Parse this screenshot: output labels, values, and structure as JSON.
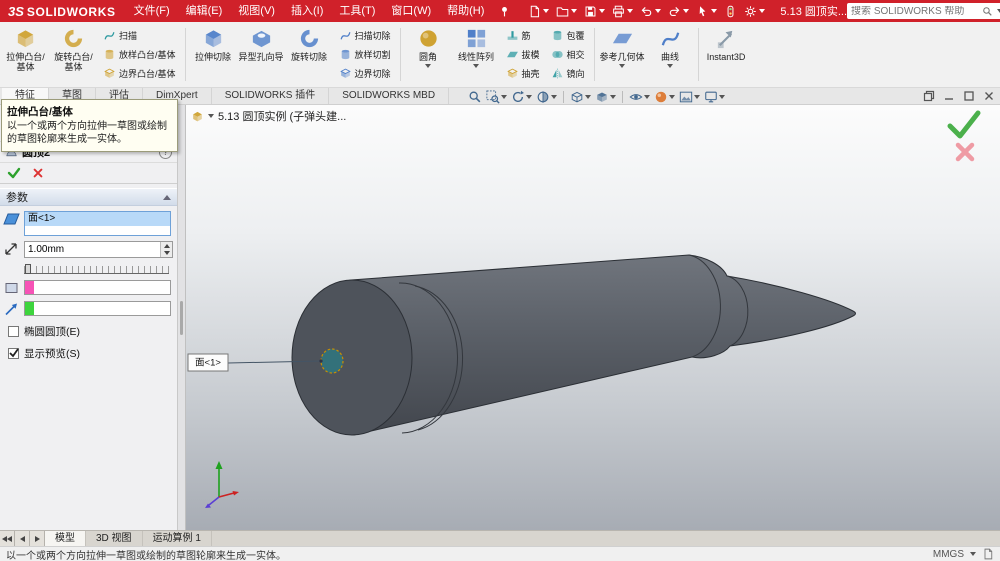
{
  "titlebar": {
    "logo_prefix": "3S",
    "logo_text": "SOLIDWORKS",
    "menus": [
      "文件(F)",
      "编辑(E)",
      "视图(V)",
      "插入(I)",
      "工具(T)",
      "窗口(W)",
      "帮助(H)"
    ],
    "document_title": "5.13 圆顶实...",
    "search_placeholder": "搜索 SOLIDWORKS 帮助",
    "help_label": "?"
  },
  "ribbon": {
    "extrude_boss": "拉伸凸台/基体",
    "revolve_boss": "旋转凸台/基体",
    "sweep": "扫描",
    "loft": "放样凸台/基体",
    "boundary_boss": "边界凸台/基体",
    "extrude_cut": "拉伸切除",
    "hole_wizard": "异型孔向导",
    "revolve_cut": "旋转切除",
    "sweep_cut": "扫描切除",
    "loft_cut": "放样切割",
    "boundary_cut": "边界切除",
    "fillet": "圆角",
    "linear_pattern": "线性阵列",
    "rib": "筋",
    "draft": "拔模",
    "shell": "抽壳",
    "wrap": "包覆",
    "intersect": "相交",
    "mirror": "镜向",
    "reference_geometry": "参考几何体",
    "curves": "曲线",
    "instant3d": "Instant3D"
  },
  "command_tabs": [
    "特征",
    "草图",
    "评估",
    "DimXpert",
    "SOLIDWORKS 插件",
    "SOLIDWORKS MBD"
  ],
  "tooltip": {
    "title": "拉伸凸台/基体",
    "body": "以一个或两个方向拉伸一草图或绘制的草图轮廓来生成一实体。"
  },
  "property_manager": {
    "title": "圆顶2",
    "help_label": "?",
    "parameters_header": "参数",
    "selected_face": "面<1>",
    "distance_value": "1.00mm",
    "elliptical_dome_label": "椭圆圆顶(E)",
    "show_preview_label": "显示预览(S)"
  },
  "viewport": {
    "document_tab": "5.13 圆顶实例 (子弹头建...",
    "face_callout": "面<1>"
  },
  "bottom_tabs": [
    "模型",
    "3D 视图",
    "运动算例 1"
  ],
  "statusbar": {
    "message": "以一个或两个方向拉伸一草图或绘制的草图轮廓来生成一实体。",
    "units": "MMGS"
  }
}
